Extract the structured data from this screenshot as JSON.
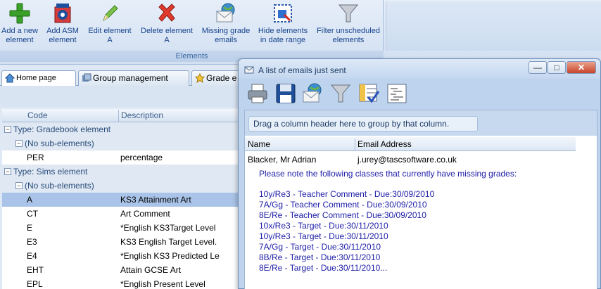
{
  "ribbon": {
    "group_label": "Elements",
    "buttons": [
      {
        "line1": "Add a new",
        "line2": "element",
        "icon": "add-plus-icon"
      },
      {
        "line1": "Add ASM",
        "line2": "element",
        "icon": "asm-gear-icon"
      },
      {
        "line1": "Edit element",
        "line2": "A",
        "icon": "pencil-icon"
      },
      {
        "line1": "Delete element",
        "line2": "A",
        "icon": "delete-x-icon"
      },
      {
        "line1": "Missing grade",
        "line2": "emails",
        "icon": "email-globe-icon"
      },
      {
        "line1": "Hide elements",
        "line2": "in date range",
        "icon": "hide-calendar-icon"
      },
      {
        "line1": "Filter unscheduled",
        "line2": "elements",
        "icon": "funnel-icon"
      }
    ]
  },
  "tabs": [
    {
      "label": "Home page",
      "icon": "home-icon"
    },
    {
      "label": "Group management",
      "icon": "group-icon"
    },
    {
      "label": "Grade e",
      "icon": "star-icon"
    }
  ],
  "grid": {
    "headers": {
      "code": "Code",
      "description": "Description"
    },
    "rows": [
      {
        "kind": "group",
        "level": 0,
        "text": "Type: Gradebook element"
      },
      {
        "kind": "group",
        "level": 1,
        "text": "(No sub-elements)"
      },
      {
        "kind": "data",
        "code": "PER",
        "desc": "percentage"
      },
      {
        "kind": "group",
        "level": 0,
        "text": "Type: Sims element"
      },
      {
        "kind": "group",
        "level": 1,
        "text": "(No sub-elements)"
      },
      {
        "kind": "data",
        "code": "A",
        "desc": "KS3 Attainment Art",
        "selected": true
      },
      {
        "kind": "data",
        "code": "CT",
        "desc": "Art Comment"
      },
      {
        "kind": "data",
        "code": "E",
        "desc": "*English KS3Target Level"
      },
      {
        "kind": "data",
        "code": "E3",
        "desc": "KS3 English Target Level."
      },
      {
        "kind": "data",
        "code": "E4",
        "desc": "*English KS3 Predicted Le"
      },
      {
        "kind": "data",
        "code": "EHT",
        "desc": "Attain GCSE  Art"
      },
      {
        "kind": "data",
        "code": "EPL",
        "desc": "*English Present Level"
      }
    ]
  },
  "dialog": {
    "title": "A list of emails just sent",
    "window_buttons": {
      "minimize": "—",
      "maximize": "□",
      "close": "✕"
    },
    "toolbar_icons": [
      "printer-icon",
      "save-disk-icon",
      "email-globe-icon",
      "funnel-icon",
      "column-chooser-icon",
      "details-list-icon"
    ],
    "group_hint": "Drag a column header here to group by that column.",
    "columns": {
      "name": "Name",
      "email": "Email Address"
    },
    "rows": [
      {
        "name": "Blacker, Mr Adrian",
        "email": "j.urey@tascsoftware.co.uk"
      }
    ],
    "note": "Please note the following classes that currently have missing grades:",
    "lines": [
      "10y/Re3 - Teacher Comment  - Due:30/09/2010",
      "7A/Gg - Teacher Comment  - Due:30/09/2010",
      "8E/Re - Teacher Comment  - Due:30/09/2010",
      "10x/Re3 - Target  - Due:30/11/2010",
      "10y/Re3 - Target  - Due:30/11/2010",
      "7A/Gg - Target  - Due:30/11/2010",
      "8B/Re - Target  - Due:30/11/2010",
      "8E/Re - Target  - Due:30/11/2010..."
    ]
  }
}
